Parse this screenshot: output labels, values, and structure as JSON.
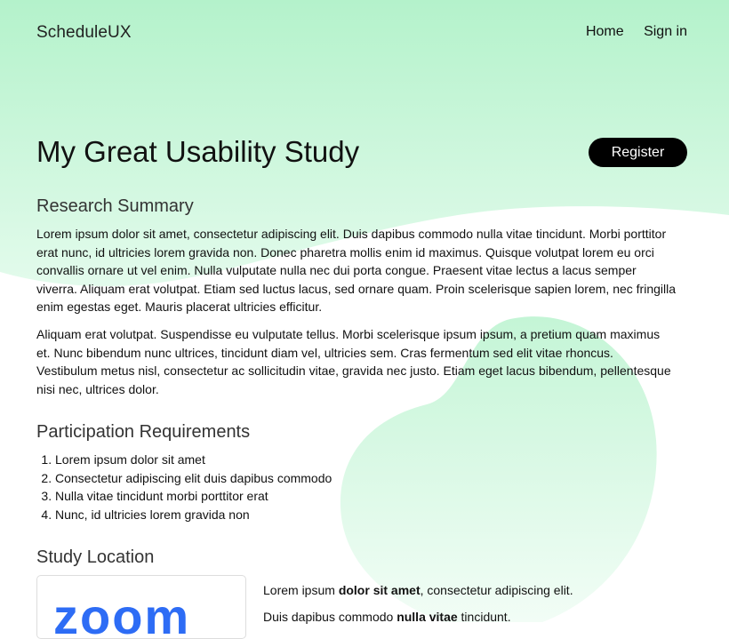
{
  "brand": "ScheduleUX",
  "nav": {
    "home": "Home",
    "sign_in": "Sign in"
  },
  "title": "My Great Usability Study",
  "register_label": "Register",
  "research_summary": {
    "heading": "Research Summary",
    "paragraphs": [
      "Lorem ipsum dolor sit amet, consectetur adipiscing elit. Duis dapibus commodo nulla vitae tincidunt. Morbi porttitor erat nunc, id ultricies lorem gravida non. Donec pharetra mollis enim id maximus. Quisque volutpat lorem eu orci convallis ornare ut vel enim. Nulla vulputate nulla nec dui porta congue. Praesent vitae lectus a lacus semper viverra. Aliquam erat volutpat. Etiam sed luctus lacus, sed ornare quam. Proin scelerisque sapien lorem, nec fringilla enim egestas eget. Mauris placerat ultricies efficitur.",
      "Aliquam erat volutpat. Suspendisse eu vulputate tellus. Morbi scelerisque ipsum ipsum, a pretium quam maximus et. Nunc bibendum nunc ultrices, tincidunt diam vel, ultricies sem. Cras fermentum sed elit vitae rhoncus. Vestibulum metus nisl, consectetur ac sollicitudin vitae, gravida nec justo. Etiam eget lacus bibendum, pellentesque nisi nec, ultrices dolor."
    ]
  },
  "participation": {
    "heading": "Participation Requirements",
    "items": [
      "Lorem ipsum dolor sit amet",
      "Consectetur adipiscing elit duis dapibus commodo",
      "Nulla vitae tincidunt morbi porttitor erat",
      "Nunc, id ultricies lorem gravida non"
    ]
  },
  "location": {
    "heading": "Study Location",
    "logo_text": "zoom",
    "line1": {
      "pre": "Lorem ipsum ",
      "bold": "dolor sit amet",
      "post": ", consectetur adipiscing elit."
    },
    "line2": {
      "pre": "Duis dapibus commodo ",
      "bold": "nulla vitae",
      "post": " tincidunt."
    }
  },
  "colors": {
    "mint": "#b6f2cc",
    "mint_light": "#d7f7e3",
    "accent_black": "#000000",
    "zoom_blue": "#2d6cf5"
  },
  "icons": []
}
